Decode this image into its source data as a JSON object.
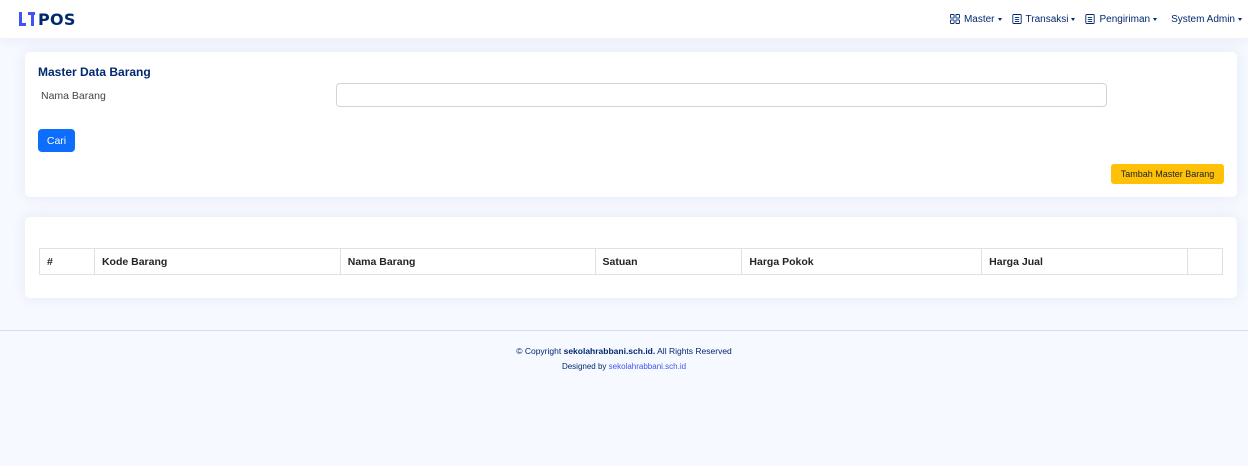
{
  "app": {
    "logo_text": "POS"
  },
  "nav": {
    "items": [
      {
        "label": "Master",
        "icon": "grid-icon"
      },
      {
        "label": "Transaksi",
        "icon": "receipt-icon"
      },
      {
        "label": "Pengiriman",
        "icon": "receipt-icon"
      }
    ],
    "user_label": "System Admin"
  },
  "search_card": {
    "title": "Master Data Barang",
    "field_label": "Nama Barang",
    "input_value": "",
    "search_button": "Cari",
    "add_button": "Tambah Master Barang"
  },
  "table": {
    "columns": [
      "#",
      "Kode Barang",
      "Nama Barang",
      "Satuan",
      "Harga Pokok",
      "Harga Jual",
      ""
    ],
    "rows": []
  },
  "footer": {
    "copyright_prefix": "© Copyright",
    "copyright_site": "sekolahrabbani.sch.id.",
    "copyright_suffix": "All Rights Reserved",
    "designed_by_prefix": "Designed by",
    "designed_by_link": "sekolahrabbani.sch.id"
  },
  "colors": {
    "brand": "#4154f1",
    "navy": "#012970",
    "primary_button": "#0d6efd",
    "warning_button": "#ffc107",
    "page_background": "#f6f9ff"
  }
}
